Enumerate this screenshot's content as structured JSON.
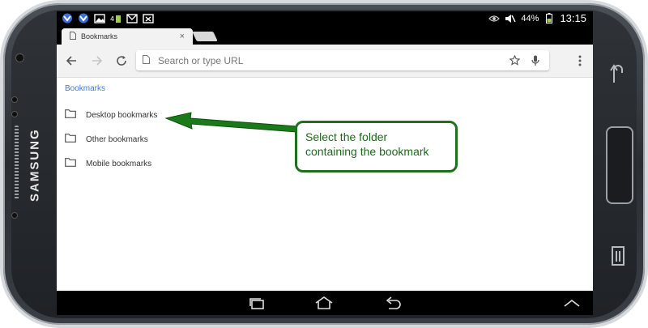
{
  "device": {
    "brand": "SAMSUNG"
  },
  "status_bar": {
    "battery": "44%",
    "time": "13:15",
    "icons_left": [
      "app-notification-icon",
      "app-notification-icon",
      "image-icon",
      "signal-4g-icon",
      "gmail-icon",
      "missed-message-icon"
    ],
    "icons_right": [
      "eye-icon",
      "mute-icon",
      "battery-icon"
    ]
  },
  "browser": {
    "tab": {
      "title": "Bookmarks",
      "close": "×"
    },
    "omnibox": {
      "placeholder": "Search or type URL"
    },
    "toolbar_icons": [
      "back-icon",
      "forward-icon",
      "reload-icon",
      "star-icon",
      "mic-icon",
      "menu-icon"
    ]
  },
  "bookmarks": {
    "breadcrumb": "Bookmarks",
    "folders": [
      {
        "label": "Desktop bookmarks"
      },
      {
        "label": "Other bookmarks"
      },
      {
        "label": "Mobile bookmarks"
      }
    ]
  },
  "callout": {
    "text_line1": "Select the folder",
    "text_line2": "containing the bookmark",
    "color": "#1f6f1f"
  },
  "colors": {
    "accent_link": "#3b78e7",
    "annotation_green": "#1f6f1f",
    "toolbar_bg": "#f2f2f2"
  }
}
